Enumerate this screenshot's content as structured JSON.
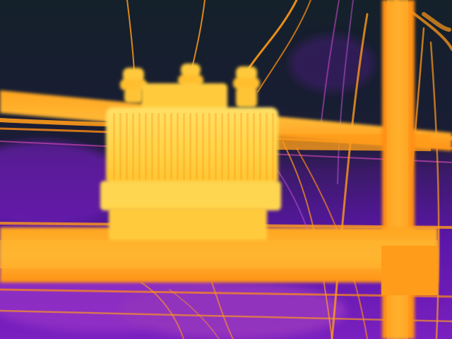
{
  "image": {
    "palette": {
      "sky_top": "#14202a",
      "sky_mid": "#3a1a66",
      "sky_low": "#5a16a8",
      "haze": "#8a2fc8",
      "hot": "#ffd24a",
      "warm": "#ff9a18",
      "glow": "#ff7a10",
      "cool_wire": "#c455d8"
    },
    "objects": [
      {
        "name": "thermal-scene-background"
      },
      {
        "name": "utility-pole"
      },
      {
        "name": "upper-crossarm"
      },
      {
        "name": "lower-crossarm"
      },
      {
        "name": "transformer-body"
      },
      {
        "name": "transformer-bushing-left"
      },
      {
        "name": "transformer-bushing-center"
      },
      {
        "name": "transformer-bushing-right"
      },
      {
        "name": "power-lines"
      }
    ]
  }
}
